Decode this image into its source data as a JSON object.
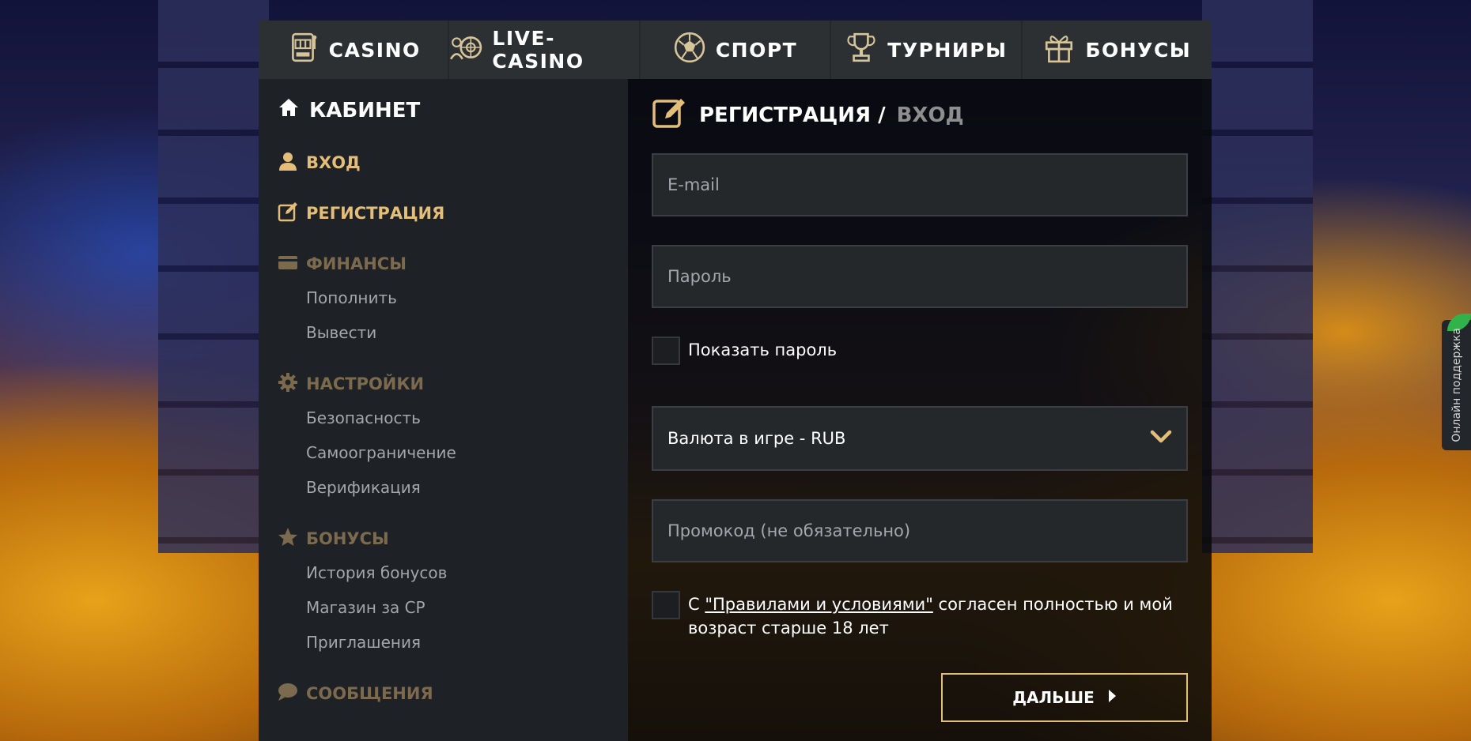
{
  "nav": {
    "tabs": [
      {
        "label": "CASINO",
        "icon": "slot-machine-icon"
      },
      {
        "label": "LIVE-CASINO",
        "icon": "roulette-icon"
      },
      {
        "label": "СПОРТ",
        "icon": "soccer-ball-icon"
      },
      {
        "label": "ТУРНИРЫ",
        "icon": "trophy-icon"
      },
      {
        "label": "БОНУСЫ",
        "icon": "gift-icon"
      }
    ]
  },
  "sidebar": {
    "title": "КАБИНЕТ",
    "links": [
      {
        "label": "ВХОД",
        "icon": "user-icon"
      },
      {
        "label": "РЕГИСТРАЦИЯ",
        "icon": "edit-icon"
      }
    ],
    "sections": [
      {
        "label": "ФИНАНСЫ",
        "icon": "card-icon",
        "items": [
          "Пополнить",
          "Вывести"
        ]
      },
      {
        "label": "НАСТРОЙКИ",
        "icon": "gear-icon",
        "items": [
          "Безопасность",
          "Самоограничение",
          "Верификация"
        ]
      },
      {
        "label": "БОНУСЫ",
        "icon": "star-icon",
        "items": [
          "История бонусов",
          "Магазин за CP",
          "Приглашения"
        ]
      },
      {
        "label": "СООБЩЕНИЯ",
        "icon": "chat-icon",
        "items": []
      }
    ]
  },
  "form": {
    "title": "РЕГИСТРАЦИЯ /",
    "title_alt": "ВХОД",
    "email_placeholder": "E-mail",
    "password_placeholder": "Пароль",
    "show_password": "Показать пароль",
    "currency": "Валюта в игре - RUB",
    "promo_placeholder": "Промокод (не обязательно)",
    "terms_prefix": "С ",
    "terms_link": "\"Правилами и условиями\"",
    "terms_suffix": " согласен полностью и мой возраст старше 18 лет",
    "next_label": "ДАЛЬШЕ"
  },
  "support": {
    "label": "Онлайн поддержка"
  },
  "colors": {
    "accent": "#e2be79",
    "muted_section": "#7b6a4d",
    "panel": "#1e2125",
    "nav": "#2d3033"
  }
}
